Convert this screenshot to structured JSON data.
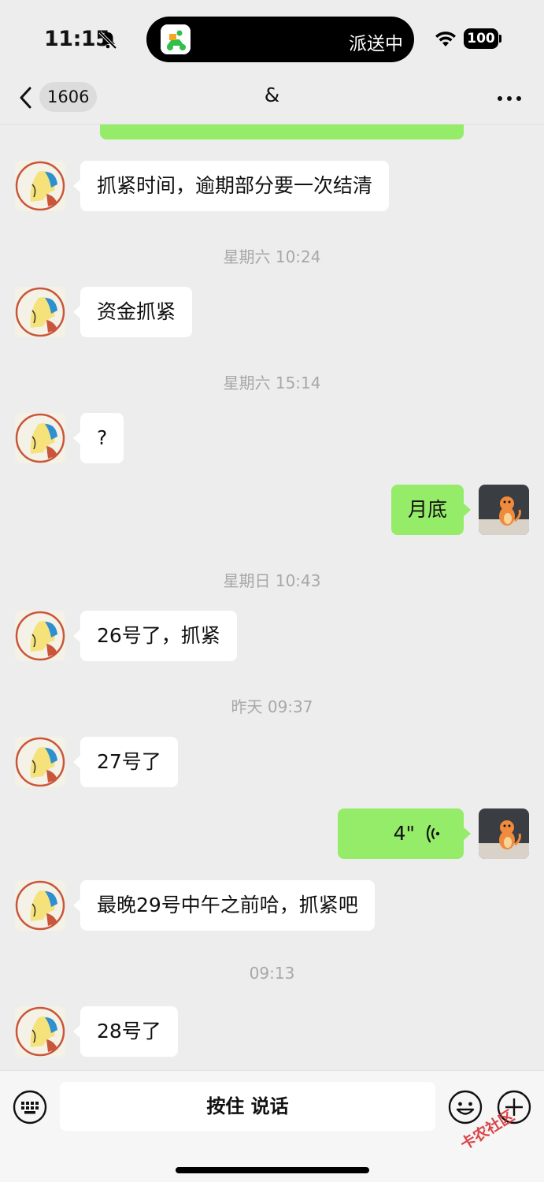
{
  "status_bar": {
    "time": "11:15",
    "live_activity_text": "派送中",
    "battery": "100"
  },
  "nav": {
    "unread_count": "1606",
    "title": "&"
  },
  "messages": [
    {
      "side": "in",
      "text": "抓紧时间，逾期部分要一次结清"
    },
    {
      "timestamp": "星期六 10:24"
    },
    {
      "side": "in",
      "text": "资金抓紧"
    },
    {
      "timestamp": "星期六 15:14"
    },
    {
      "side": "in",
      "text": "?"
    },
    {
      "side": "out",
      "text": "月底"
    },
    {
      "timestamp": "星期日 10:43"
    },
    {
      "side": "in",
      "text": "26号了，抓紧"
    },
    {
      "timestamp": "昨天 09:37"
    },
    {
      "side": "in",
      "text": "27号了"
    },
    {
      "side": "out",
      "type": "voice",
      "text": "4\""
    },
    {
      "side": "in",
      "text": "最晚29号中午之前哈，抓紧吧"
    },
    {
      "timestamp": "09:13"
    },
    {
      "side": "in",
      "text": "28号了"
    }
  ],
  "input_bar": {
    "hold_to_talk": "按住 说话"
  },
  "watermark": "卡农社区",
  "colors": {
    "background": "#ededed",
    "outgoing_bubble": "#95ec69",
    "incoming_bubble": "#ffffff",
    "timestamp": "#a8a8a8"
  }
}
